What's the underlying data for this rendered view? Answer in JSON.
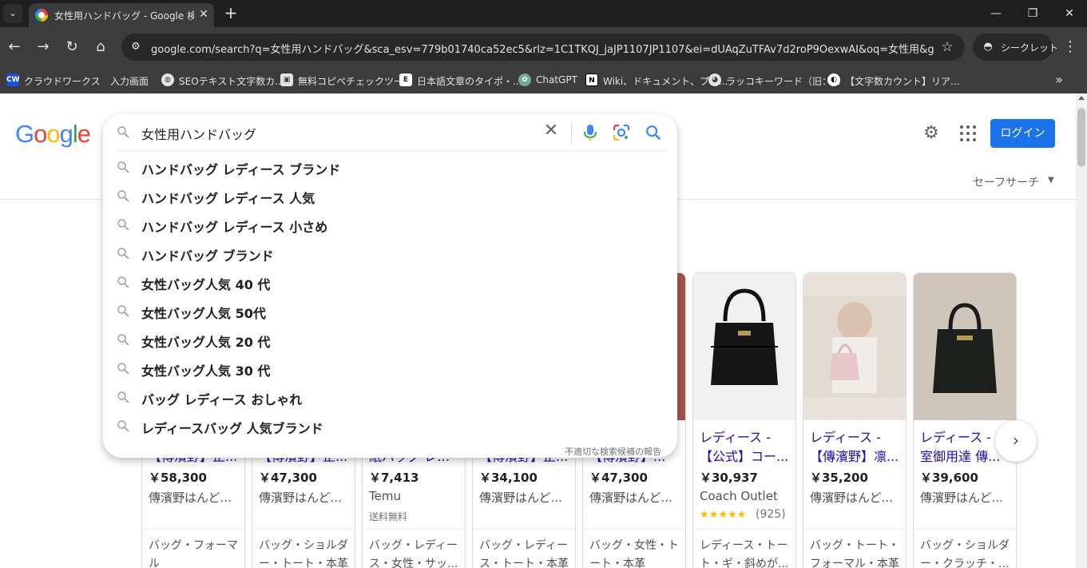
{
  "browser": {
    "tab_title": "女性用ハンドバッグ - Google 検索",
    "url": "google.com/search?q=女性用ハンドバッグ&sca_esv=779b01740ca52ec5&rlz=1C1TKQJ_jaJP1107JP1107&ei=dUAqZuTFAv7d2roP9OexwAI&oq=女性用&gs_lp=...",
    "incognito_label": "シークレット",
    "bookmarks": [
      {
        "label": "クラウドワークス",
        "icon": "CW"
      },
      {
        "label": "入力画面",
        "icon": ""
      },
      {
        "label": "SEOテキスト文字数カ...",
        "icon": "globe-icon"
      },
      {
        "label": "無料コピペチェックツー...",
        "icon": "image-icon"
      },
      {
        "label": "日本語文章のタイポ・...",
        "icon": "E"
      },
      {
        "label": "ChatGPT",
        "icon": "chatgpt-icon"
      },
      {
        "label": "Wiki、ドキュメント、プロ...",
        "icon": "N"
      },
      {
        "label": "ラッコキーワード（旧：...",
        "icon": "rakko-icon"
      },
      {
        "label": "【文字数カウント】リア...",
        "icon": "count-icon"
      }
    ]
  },
  "header": {
    "logo": [
      "G",
      "o",
      "o",
      "g",
      "l",
      "e"
    ],
    "login_label": "ログイン",
    "safesearch_label": "セーフサーチ"
  },
  "search": {
    "query": "女性用ハンドバッグ",
    "report_label": "不適切な検索候補の報告",
    "suggestions": [
      "ハンドバッグ レディース ブランド",
      "ハンドバッグ レディース 人気",
      "ハンドバッグ レディース 小さめ",
      "ハンドバッグ ブランド",
      "女性バッグ人気 40 代",
      "女性バッグ人気 50代",
      "女性バッグ人気 20 代",
      "女性バッグ人気 30 代",
      "バッグ レディース おしゃれ",
      "レディースバッグ 人気ブランド"
    ]
  },
  "products": [
    {
      "t1": "",
      "t2": "【傳濱野】正...",
      "price": "￥58,300",
      "seller": "傳濱野はんど...",
      "extra": "",
      "tags1": "バッグ・フォーマ",
      "tags2": "ル"
    },
    {
      "t1": "",
      "t2": "【傳濱野】正...",
      "price": "￥47,300",
      "seller": "傳濱野はんど...",
      "extra": "",
      "tags1": "バッグ・ショルダ",
      "tags2": "ー・トート・本革"
    },
    {
      "t1": "",
      "t2": "紙バッグ レデ...",
      "price": "￥7,413",
      "seller": "Temu",
      "extra": "送料無料",
      "tags1": "バッグ・レディー",
      "tags2": "ス・女性・サッ..."
    },
    {
      "t1": "",
      "t2": "【傳濱野】正...",
      "price": "￥34,100",
      "seller": "傳濱野はんど...",
      "extra": "",
      "tags1": "バッグ・レディー",
      "tags2": "ス・トート・本革"
    },
    {
      "t1": "",
      "t2": "【傳濱野】...",
      "price": "￥47,300",
      "seller": "傳濱野はんど...",
      "extra": "",
      "tags1": "バッグ・女性・ト",
      "tags2": "ート・本革"
    },
    {
      "t1": "レディース -",
      "t2": "【公式】コー...",
      "price": "￥30,937",
      "seller": "Coach Outlet",
      "rating": "★★★★★",
      "rating_count": "(925)",
      "tags1": "レディース・トー",
      "tags2": "ト・ギ・斜めが..."
    },
    {
      "t1": "レディース -",
      "t2": "【傳濱野】凛...",
      "price": "￥35,200",
      "seller": "傳濱野はんど...",
      "extra": "",
      "tags1": "バッグ・トート・",
      "tags2": "フォーマル・本革"
    },
    {
      "t1": "レディース - 皇",
      "t2": "室御用達 傳...",
      "price": "￥39,600",
      "seller": "傳濱野はんど...",
      "extra": "",
      "tags1": "バッグ・ショルダ",
      "tags2": "ー・クラッチ・..."
    }
  ],
  "colors": {
    "link": "#1a0dab",
    "login_bg": "#1a73e8",
    "chrome_dark": "#3c3c3c"
  }
}
